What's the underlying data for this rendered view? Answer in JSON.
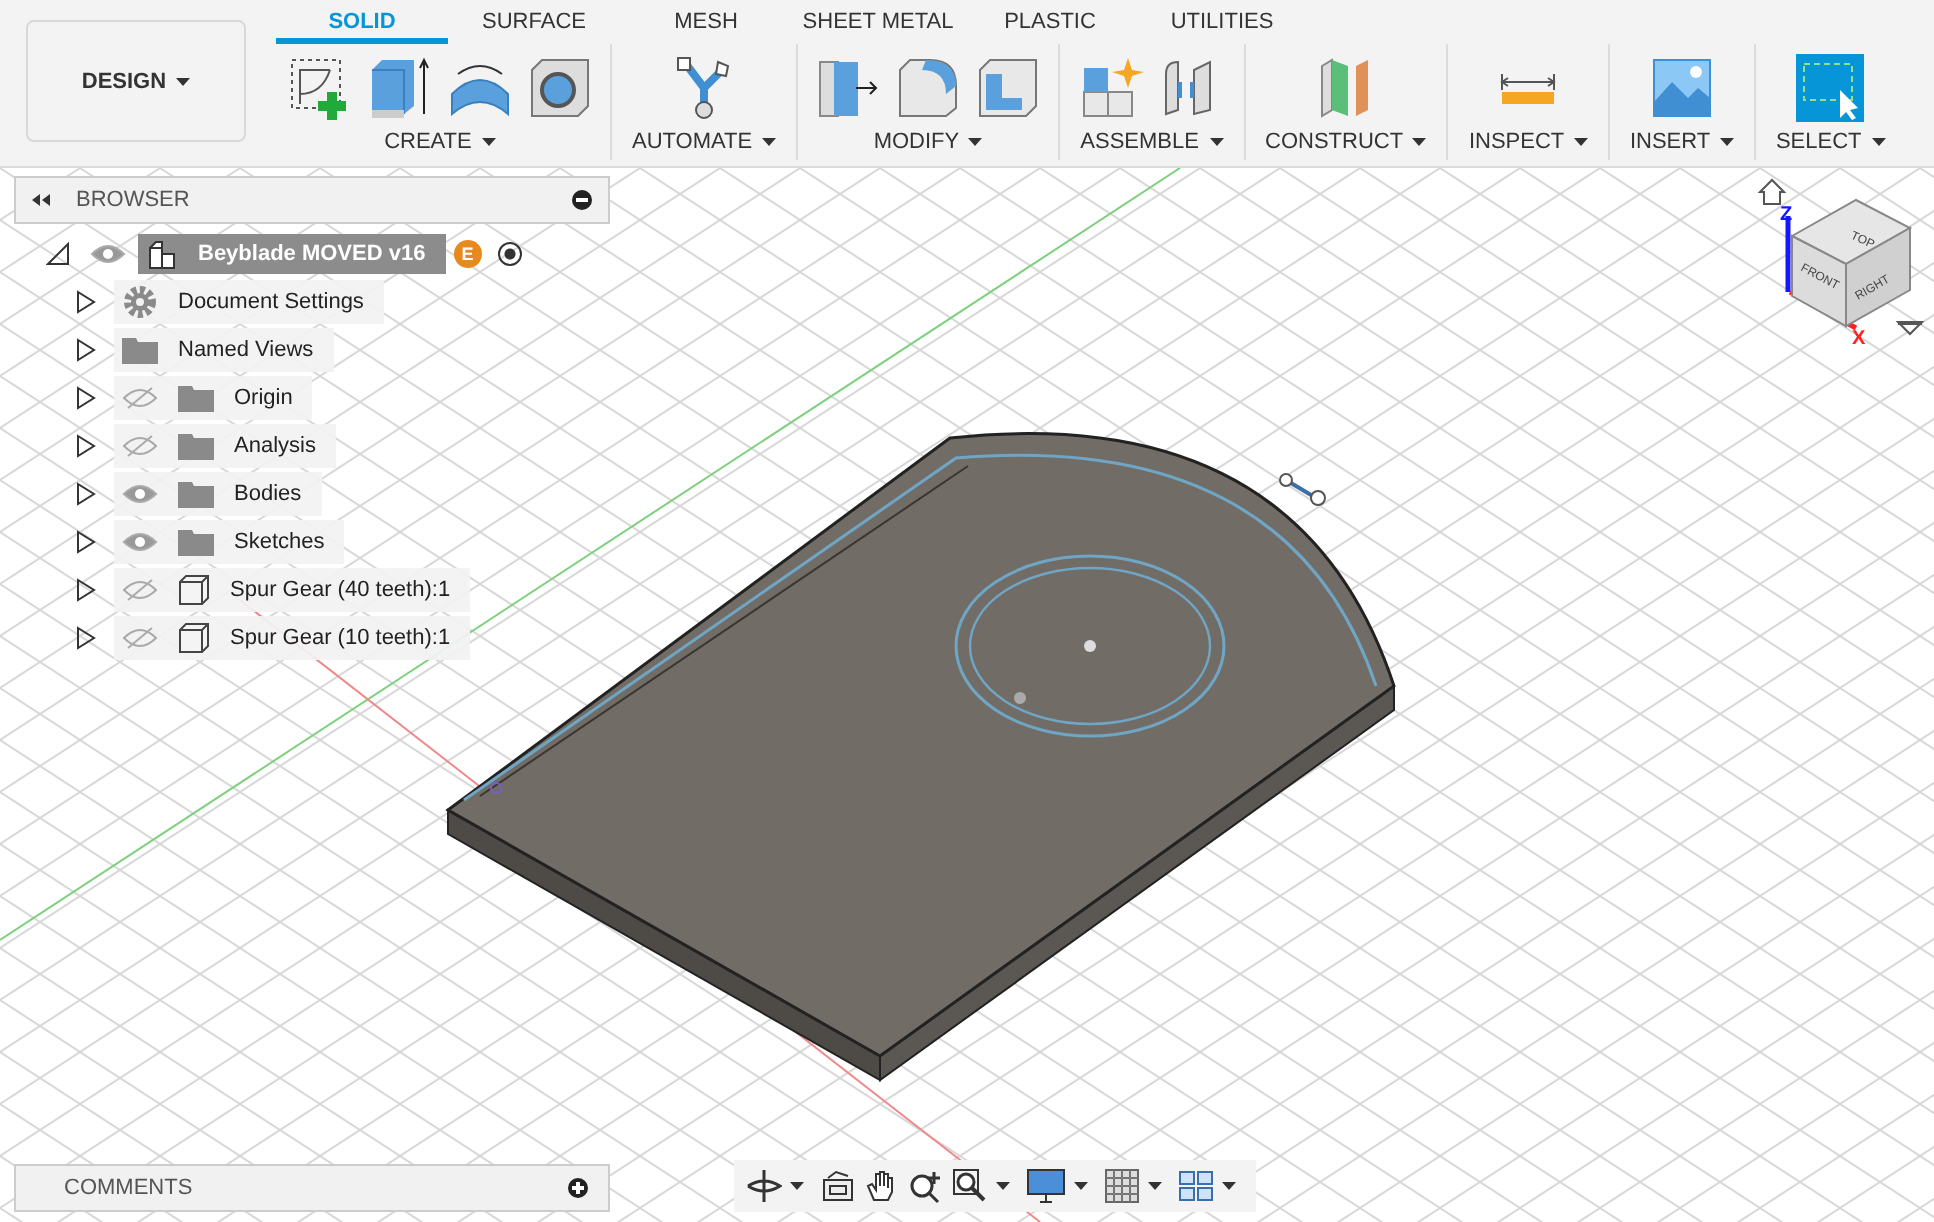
{
  "workspace": {
    "label": "DESIGN"
  },
  "tabs": [
    {
      "label": "SOLID",
      "selected": true
    },
    {
      "label": "SURFACE",
      "selected": false
    },
    {
      "label": "MESH",
      "selected": false
    },
    {
      "label": "SHEET METAL",
      "selected": false
    },
    {
      "label": "PLASTIC",
      "selected": false
    },
    {
      "label": "UTILITIES",
      "selected": false
    }
  ],
  "tool_groups": [
    {
      "label": "CREATE",
      "kind": "create"
    },
    {
      "label": "AUTOMATE",
      "kind": "automate"
    },
    {
      "label": "MODIFY",
      "kind": "modify"
    },
    {
      "label": "ASSEMBLE",
      "kind": "assemble"
    },
    {
      "label": "CONSTRUCT",
      "kind": "construct"
    },
    {
      "label": "INSPECT",
      "kind": "inspect"
    },
    {
      "label": "INSERT",
      "kind": "insert"
    },
    {
      "label": "SELECT",
      "kind": "select"
    }
  ],
  "browser": {
    "title": "BROWSER",
    "root": {
      "label": "Beyblade MOVED v16",
      "expanded": true,
      "visible": true,
      "badge": "E",
      "active": true
    },
    "items": [
      {
        "label": "Document Settings",
        "kind": "settings",
        "expanded": false
      },
      {
        "label": "Named Views",
        "kind": "folder",
        "expanded": false
      },
      {
        "label": "Origin",
        "kind": "folder",
        "expanded": false,
        "visible": false
      },
      {
        "label": "Analysis",
        "kind": "folder",
        "expanded": false,
        "visible": false
      },
      {
        "label": "Bodies",
        "kind": "folder",
        "expanded": false,
        "visible": true
      },
      {
        "label": "Sketches",
        "kind": "folder",
        "expanded": false,
        "visible": true
      },
      {
        "label": "Spur Gear (40 teeth):1",
        "kind": "component",
        "expanded": false,
        "visible": false
      },
      {
        "label": "Spur Gear (10 teeth):1",
        "kind": "component",
        "expanded": false,
        "visible": false
      }
    ]
  },
  "view_cube": {
    "faces": [
      "TOP",
      "FRONT",
      "RIGHT"
    ],
    "axes": [
      "Z",
      "X"
    ]
  },
  "comments": {
    "title": "COMMENTS"
  }
}
